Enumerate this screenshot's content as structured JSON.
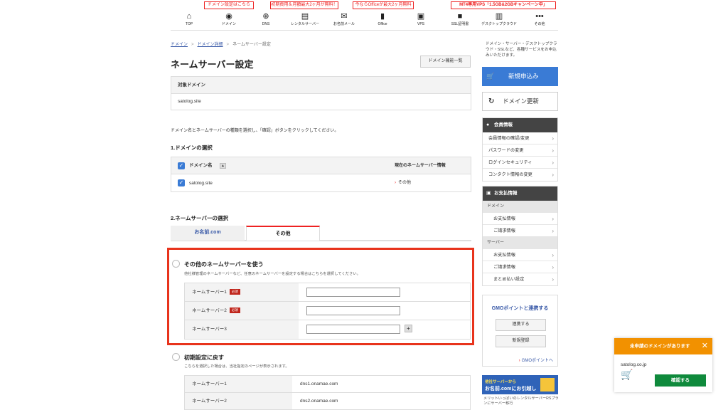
{
  "promos": [
    {
      "text": "ドメイン設定はこちら"
    },
    {
      "text": "初期費用＆月額最大2ヶ月が無料！"
    },
    {
      "text": "今ならOfficeが最大2ヶ月無料"
    },
    {
      "text": "MT4専用VPS「1.5GB&2GBキャンペーン中」"
    }
  ],
  "nav": [
    {
      "label": "TOP",
      "icon": "home-icon"
    },
    {
      "label": "ドメイン",
      "icon": "domain-icon"
    },
    {
      "label": "DNS",
      "icon": "globe-icon"
    },
    {
      "label": "レンタルサーバー",
      "icon": "server-icon"
    },
    {
      "label": "お名前メール",
      "icon": "mail-icon"
    },
    {
      "label": "Office",
      "icon": "office-icon"
    },
    {
      "label": "VPS",
      "icon": "vps-icon"
    },
    {
      "label": "SSL証明書",
      "icon": "lock-icon"
    },
    {
      "label": "デスクトップクラウド",
      "icon": "chart-icon"
    },
    {
      "label": "その他",
      "icon": "more-icon"
    }
  ],
  "breadcrumb": {
    "item1": "ドメイン",
    "item2": "ドメイン詳細",
    "item3": "ネームサーバー設定",
    "sep": ">"
  },
  "page": {
    "title": "ネームサーバー設定",
    "domain_list_button": "ドメイン機能一覧",
    "target_header": "対象ドメイン",
    "target_domain": "satolog.site",
    "description": "ドメイン名とネームサーバーの種類を選択し、「確認」ボタンをクリックしてください。",
    "section1": "1.ドメインの選択",
    "section2": "2.ネームサーバーの選択"
  },
  "domain_table": {
    "col_domain": "ドメイン名",
    "sort_icon": "▲",
    "col_current": "現在のネームサーバー情報",
    "rows": [
      {
        "domain": "satolog.site",
        "current": "その他"
      }
    ]
  },
  "tabs": {
    "tab1": "お名前.com",
    "tab2": "その他"
  },
  "option_other": {
    "title": "その他のネームサーバーを使う",
    "desc": "他社様管理のネームサーバーなど、任意のネームサーバーを設定する場合はこちらを選択してください。",
    "required": "必須",
    "rows": [
      {
        "label": "ネームサーバー1",
        "value": ""
      },
      {
        "label": "ネームサーバー2",
        "value": ""
      },
      {
        "label": "ネームサーバー3",
        "value": ""
      }
    ]
  },
  "option_default": {
    "title": "初期設定に戻す",
    "desc": "こちらを選択した場合は、当社指定のページが表示されます。",
    "rows": [
      {
        "label": "ネームサーバー1",
        "value": "dns1.onamae.com"
      },
      {
        "label": "ネームサーバー2",
        "value": "dns2.onamae.com"
      }
    ]
  },
  "sidebar": {
    "intro": "ドメイン・サーバー・デスクトップクラウド・SSLなど、各種サービスをお申込みいただけます。",
    "new_button": "新規申込み",
    "renew_button": "ドメイン更新",
    "member": {
      "header": "会員情報",
      "items": [
        "会員情報の確認/変更",
        "パスワードの変更",
        "ログインセキュリティ",
        "コンタクト情報の変更"
      ]
    },
    "payment": {
      "header": "お支払情報",
      "domain_label": "ドメイン",
      "domain_items": [
        "お支払情報",
        "ご請求情報"
      ],
      "server_label": "サーバー",
      "server_items": [
        "お支払情報",
        "ご請求情報",
        "まとめ払い設定"
      ]
    },
    "gmo": {
      "title": "GMOポイントと連携する",
      "link_button": "連携する",
      "register_button": "新規登録",
      "link": "GMOポイントへ"
    },
    "banner": {
      "line1": "他社サーバーから",
      "line2": "お名前.comにお引越し",
      "caption": "メリットいっぱいのレンタルサーバーRSプランにサーバー移行"
    }
  },
  "popup": {
    "title": "未申請のドメインがあります",
    "domain": "satolog.co.jp",
    "button": "確認する",
    "close": "✕"
  },
  "colors": {
    "accent": "#3a7bd5",
    "highlight": "#e8331c",
    "popup": "#f29100",
    "confirm": "#0f8a3c"
  }
}
